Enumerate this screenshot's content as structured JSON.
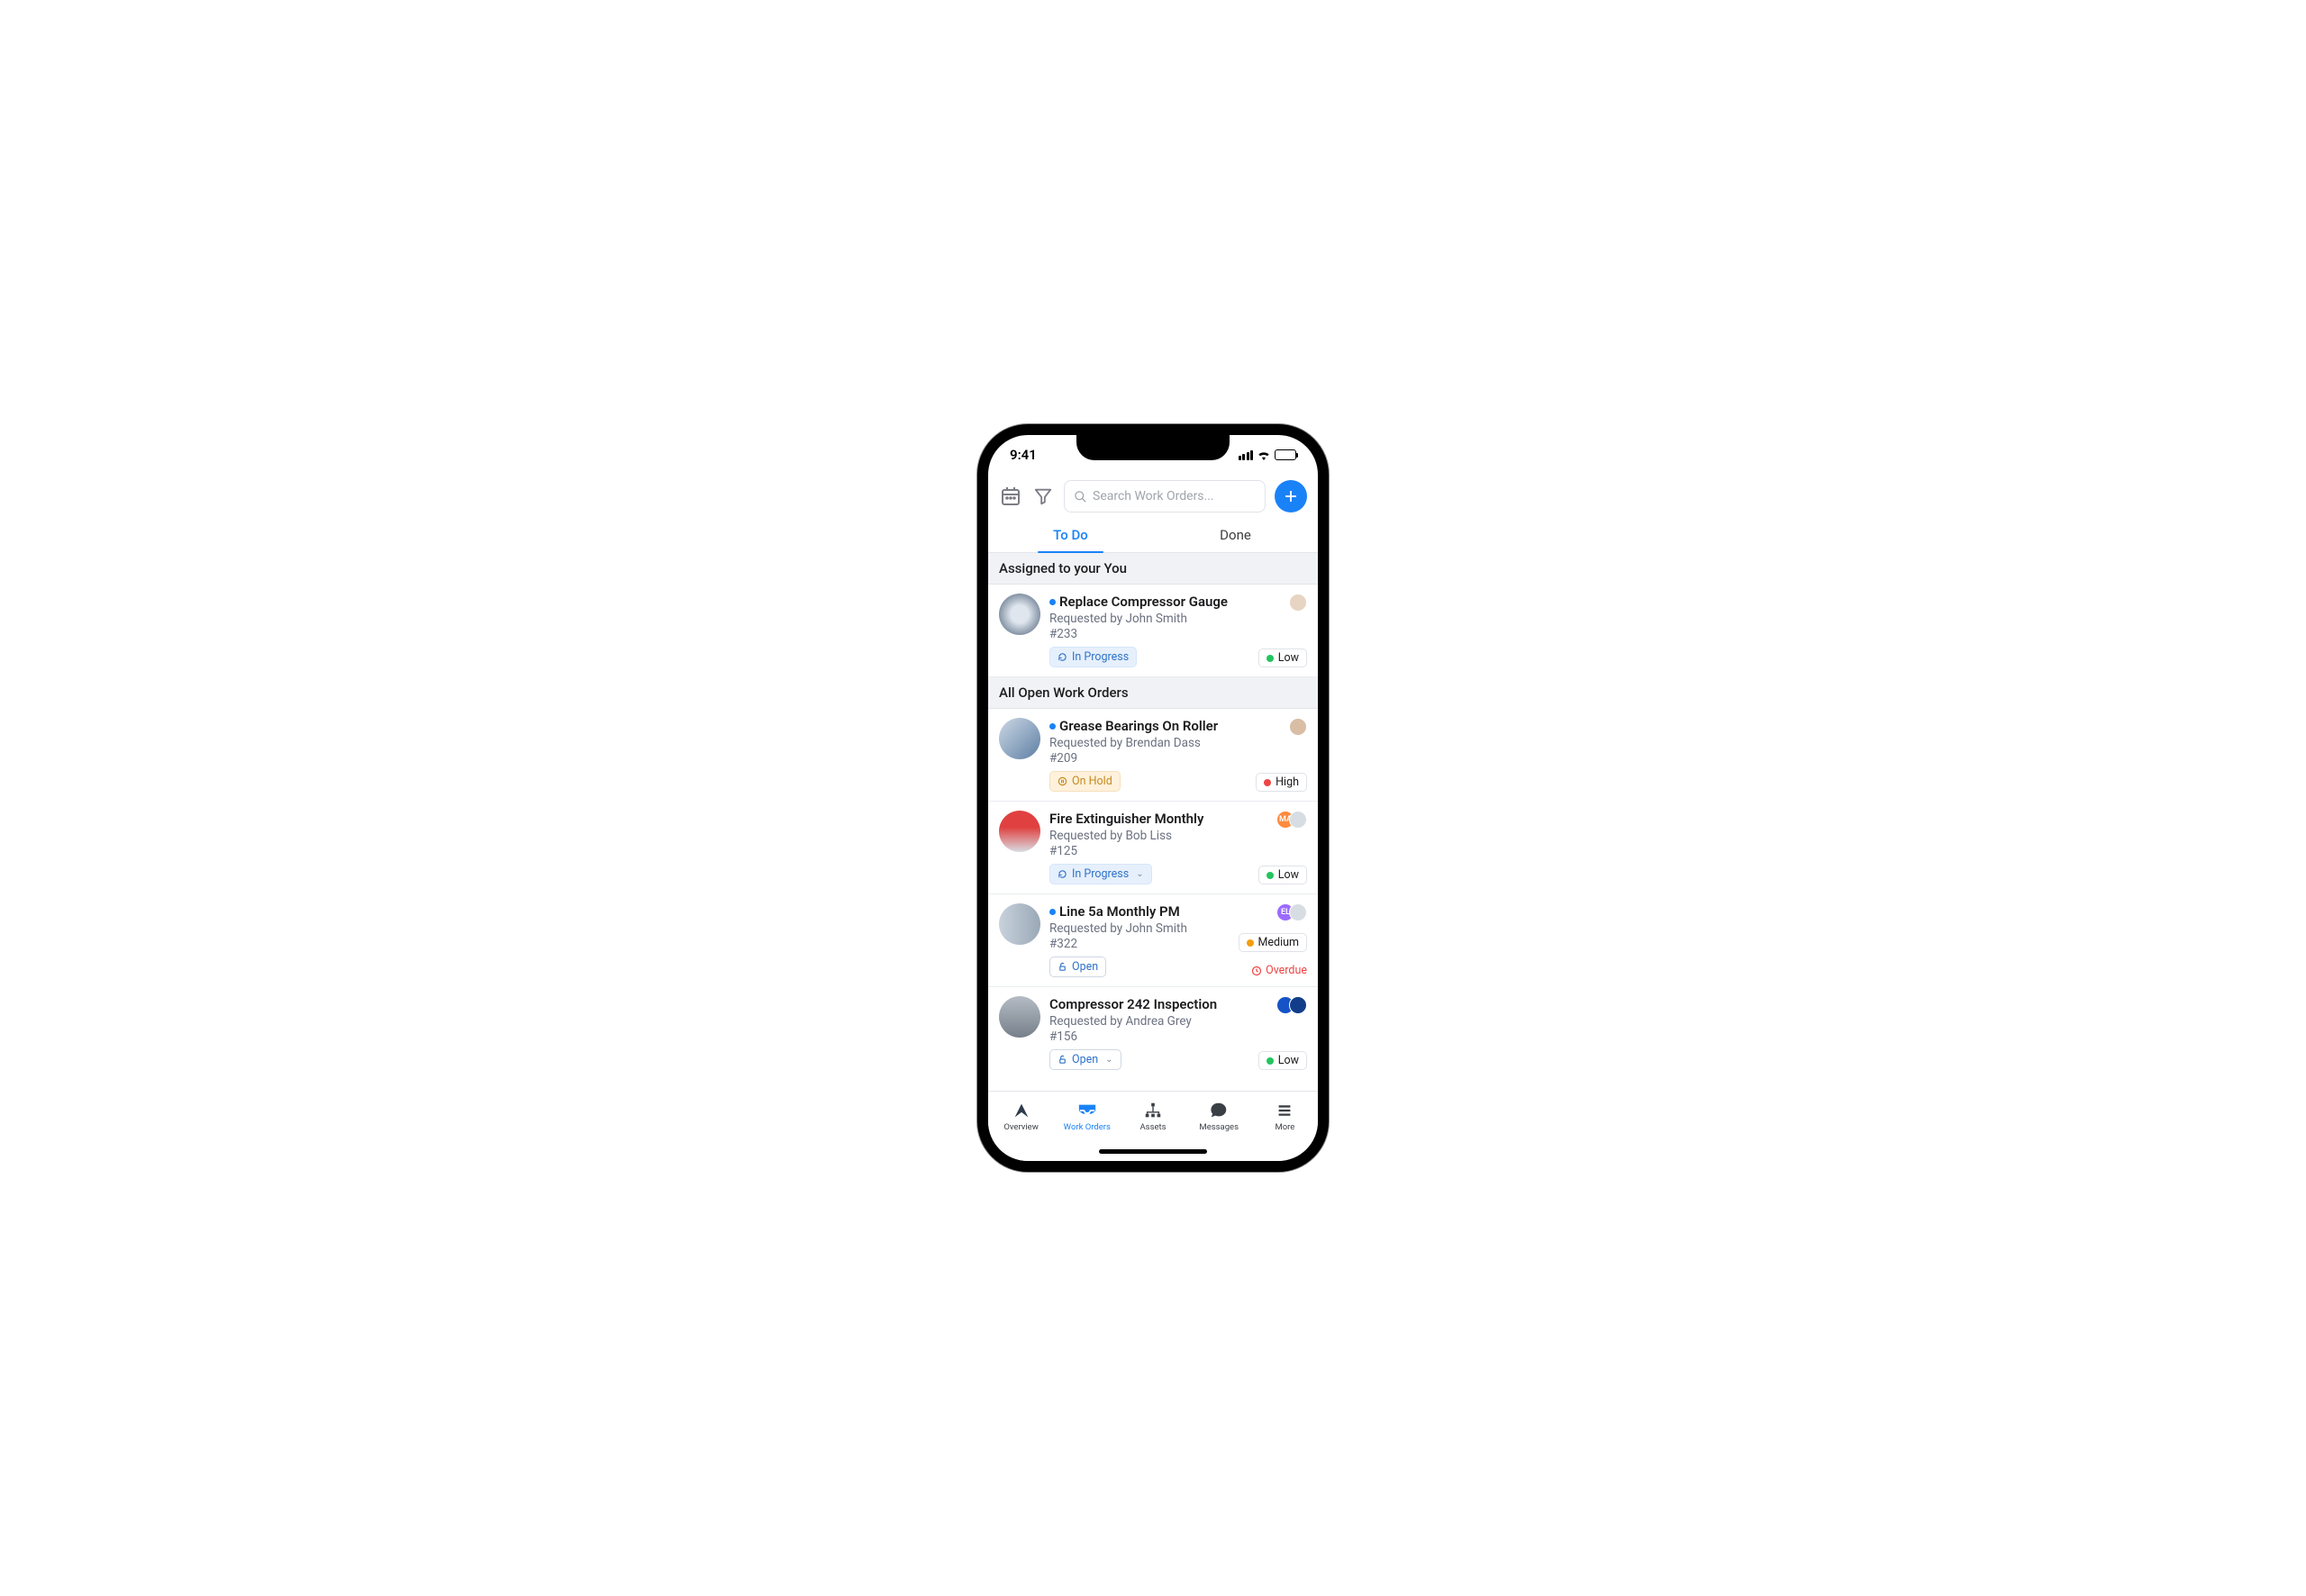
{
  "statusbar": {
    "time": "9:41"
  },
  "toolbar": {
    "search_placeholder": "Search Work Orders..."
  },
  "tabs": {
    "todo": "To Do",
    "done": "Done"
  },
  "sections": {
    "assigned": "Assigned to  your You",
    "all_open": "All Open Work Orders"
  },
  "work_orders": [
    {
      "title": "Replace Compressor Gauge",
      "requested_by": "Requested by John Smith",
      "id": "#233",
      "status": "In Progress",
      "priority": "Low",
      "unread": true
    },
    {
      "title": "Grease Bearings On Roller",
      "requested_by": "Requested by Brendan Dass",
      "id": "#209",
      "status": "On Hold",
      "priority": "High",
      "unread": true
    },
    {
      "title": "Fire Extinguisher Monthly",
      "requested_by": "Requested by Bob Liss",
      "id": "#125",
      "status": "In Progress",
      "priority": "Low",
      "unread": false
    },
    {
      "title": "Line 5a Monthly PM",
      "requested_by": "Requested by John Smith",
      "id": "#322",
      "status": "Open",
      "priority": "Medium",
      "overdue": "Overdue",
      "unread": true
    },
    {
      "title": "Compressor 242 Inspection",
      "requested_by": "Requested by Andrea Grey",
      "id": "#156",
      "status": "Open",
      "priority": "Low",
      "unread": false
    }
  ],
  "nav": {
    "overview": "Overview",
    "work_orders": "Work Orders",
    "assets": "Assets",
    "messages": "Messages",
    "more": "More"
  }
}
